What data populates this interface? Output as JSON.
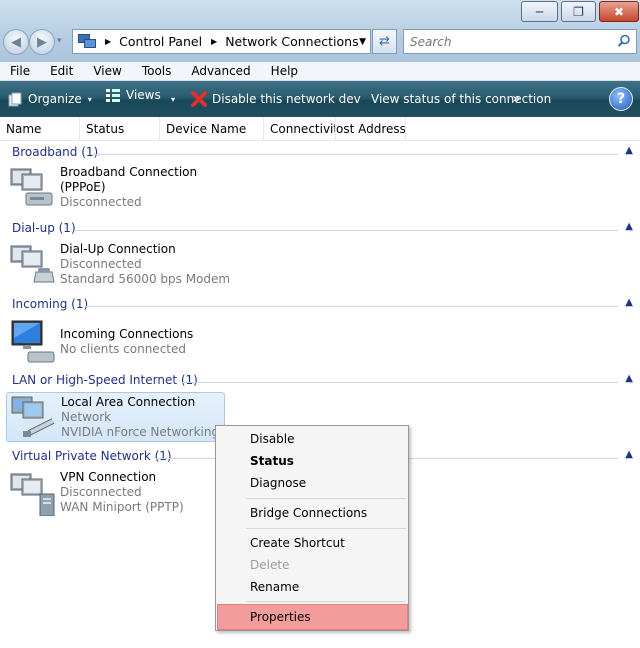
{
  "window": {
    "minimize_glyph": "─",
    "maximize_glyph": "❐",
    "close_glyph": "✖"
  },
  "nav": {
    "back_glyph": "◀",
    "forward_glyph": "▶",
    "dropdown_glyph": "▾"
  },
  "address": {
    "crumbs": [
      "Control Panel",
      "Network Connections"
    ],
    "separator": "▶",
    "dropdown_glyph": "▼",
    "refresh_glyph": "⇄"
  },
  "search": {
    "placeholder": "Search"
  },
  "menubar": {
    "items": [
      "File",
      "Edit",
      "View",
      "Tools",
      "Advanced",
      "Help"
    ]
  },
  "toolbar": {
    "organize": "Organize",
    "views": "Views",
    "disable": "Disable this network dev",
    "view_status": "View status of this connection",
    "more": "»",
    "help": "?"
  },
  "columns": [
    "Name",
    "Status",
    "Device Name",
    "Connectivity",
    "Host Address"
  ],
  "groups": [
    {
      "title": "Broadband (1)",
      "items": [
        {
          "name": "Broadband Connection",
          "lines": [
            "(PPPoE)"
          ],
          "sub": [
            "Disconnected"
          ],
          "icon": "broadband-connection-icon"
        }
      ]
    },
    {
      "title": "Dial-up (1)",
      "items": [
        {
          "name": "Dial-Up Connection",
          "lines": [],
          "sub": [
            "Disconnected",
            "Standard 56000 bps Modem"
          ],
          "icon": "dialup-connection-icon"
        }
      ]
    },
    {
      "title": "Incoming (1)",
      "items": [
        {
          "name": "Incoming Connections",
          "lines": [],
          "sub": [
            "No clients connected"
          ],
          "icon": "incoming-connection-icon"
        }
      ]
    },
    {
      "title": "LAN or High-Speed Internet (1)",
      "items": [
        {
          "name": "Local Area Connection",
          "lines": [],
          "sub": [
            "Network",
            "NVIDIA nForce Networking ..."
          ],
          "icon": "lan-connection-icon"
        }
      ]
    },
    {
      "title": "Virtual Private Network (1)",
      "items": [
        {
          "name": "VPN Connection",
          "lines": [],
          "sub": [
            "Disconnected",
            "WAN Miniport (PPTP)"
          ],
          "icon": "vpn-connection-icon"
        }
      ]
    }
  ],
  "context_menu": {
    "items": [
      "Disable",
      "Status",
      "Diagnose",
      "Bridge Connections",
      "Create Shortcut",
      "Delete",
      "Rename",
      "Properties"
    ]
  },
  "colors": {
    "group_title": "#1e3287",
    "highlight": "#f39c9c",
    "toolbar_bg": "#2a5b6e"
  }
}
